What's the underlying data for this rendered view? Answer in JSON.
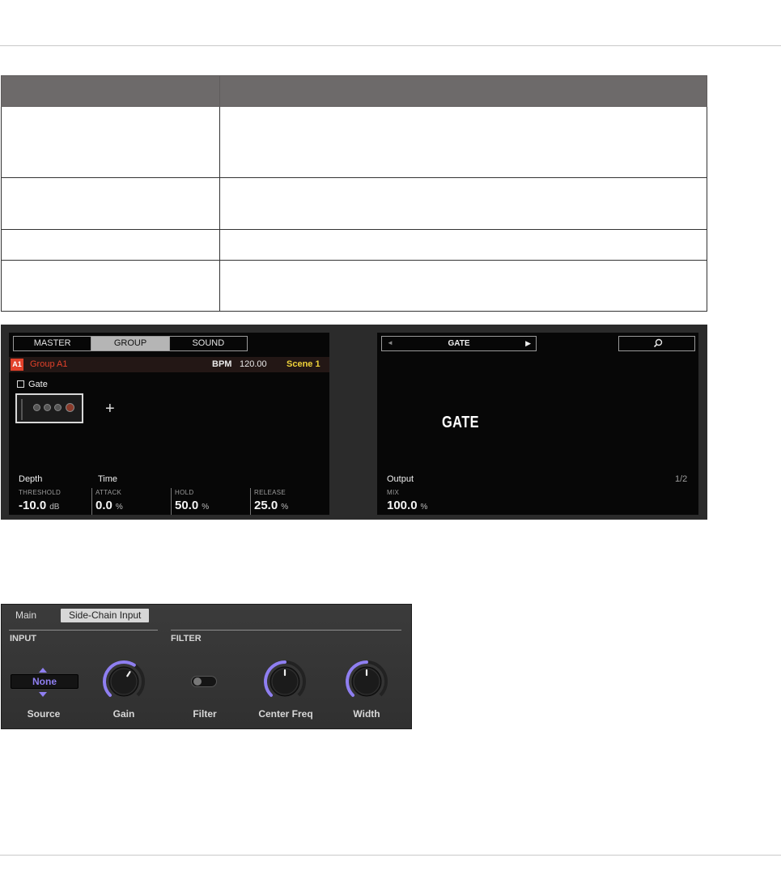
{
  "table": {
    "headers": [
      "",
      ""
    ],
    "rows": [
      [
        "",
        ""
      ],
      [
        "",
        ""
      ],
      [
        "",
        ""
      ],
      [
        "",
        ""
      ]
    ]
  },
  "hardware": {
    "tabs": [
      "MASTER",
      "GROUP",
      "SOUND"
    ],
    "active_tab": "GROUP",
    "group_badge": "A1",
    "group_name": "Group A1",
    "bpm_label": "BPM",
    "bpm_value": "120.00",
    "scene": "Scene 1",
    "plugin_name": "Gate",
    "add_slot": "+",
    "left_params": {
      "section_labels": [
        "Depth",
        "Time"
      ],
      "params": [
        {
          "name": "THRESHOLD",
          "value": "-10.0",
          "unit": "dB"
        },
        {
          "name": "ATTACK",
          "value": "0.0",
          "unit": "%"
        },
        {
          "name": "HOLD",
          "value": "50.0",
          "unit": "%"
        },
        {
          "name": "RELEASE",
          "value": "25.0",
          "unit": "%"
        }
      ]
    },
    "right": {
      "prev_arrow": "◄",
      "preset": "GATE",
      "next_arrow": "▶",
      "big_title": "GATE",
      "section_label": "Output",
      "page": "1/2",
      "params": [
        {
          "name": "MIX",
          "value": "100.0",
          "unit": "%"
        }
      ]
    }
  },
  "panel": {
    "tabs": [
      "Main",
      "Side-Chain Input"
    ],
    "active_tab": "Side-Chain Input",
    "sections": [
      "INPUT",
      "FILTER"
    ],
    "source_value": "None",
    "controls": [
      "Source",
      "Gain",
      "Filter",
      "Center Freq",
      "Width"
    ],
    "knob_levels": {
      "gain": 0.62,
      "center_freq": 0.5,
      "width": 0.5
    },
    "filter_on": false,
    "accent": "#8f7ff1"
  }
}
